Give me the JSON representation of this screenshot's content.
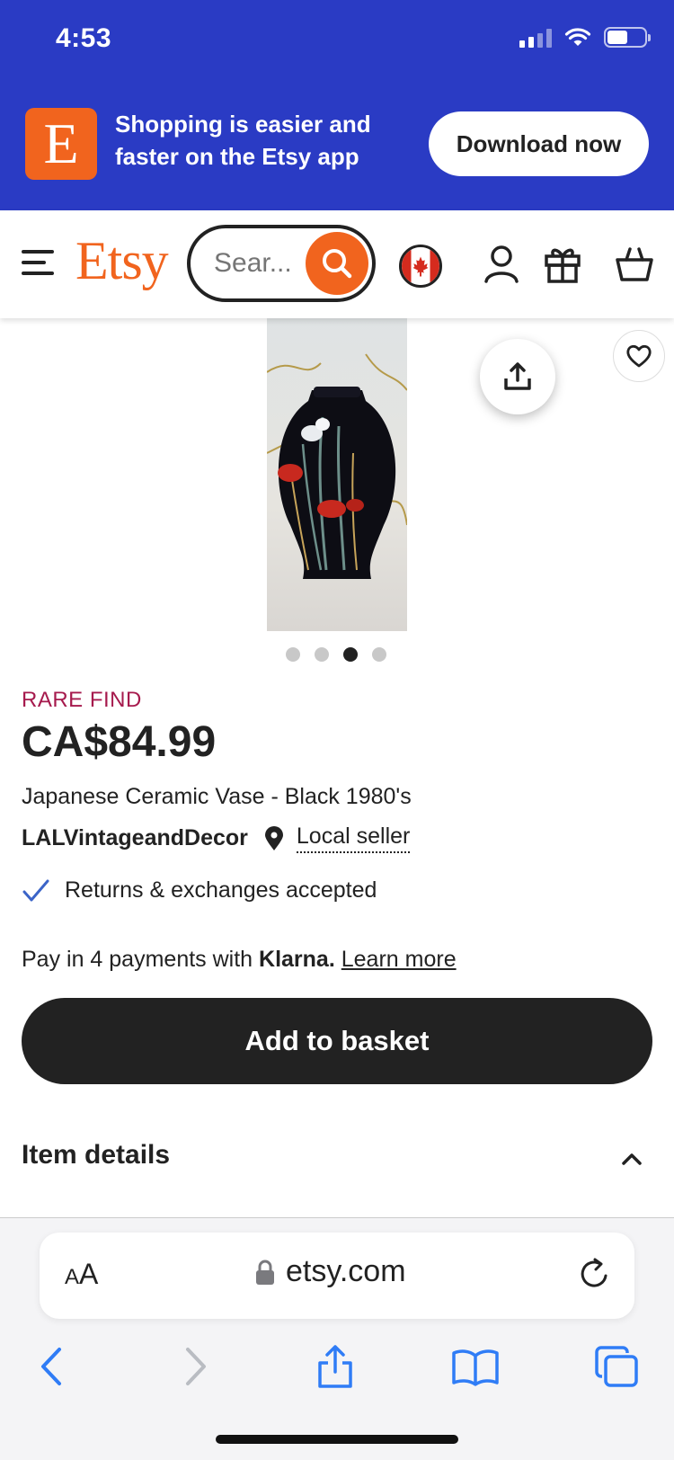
{
  "status_bar": {
    "time": "4:53"
  },
  "app_banner": {
    "logo_letter": "E",
    "message": "Shopping is easier and faster on the Etsy app",
    "download_label": "Download now"
  },
  "header": {
    "logo": "Etsy",
    "search_placeholder": "Sear..."
  },
  "gallery": {
    "image_count": 4,
    "active_index": 2
  },
  "product": {
    "badge": "RARE FIND",
    "price": "CA$84.99",
    "title": "Japanese Ceramic Vase - Black 1980's",
    "seller": "LALVintageandDecor",
    "local_seller_label": "Local seller",
    "returns_text": "Returns & exchanges accepted",
    "klarna": {
      "prefix": "Pay in 4 payments with",
      "brand": "Klarna.",
      "link": "Learn more"
    },
    "add_to_basket_label": "Add to basket",
    "item_details_label": "Item details"
  },
  "browser": {
    "text_size_label_big": "A",
    "text_size_label_small": "A",
    "url": "etsy.com"
  },
  "colors": {
    "banner_blue": "#2a3bc4",
    "etsy_orange": "#f1641e",
    "rare_find": "#a61a4d",
    "safari_blue": "#2f7cf6"
  }
}
